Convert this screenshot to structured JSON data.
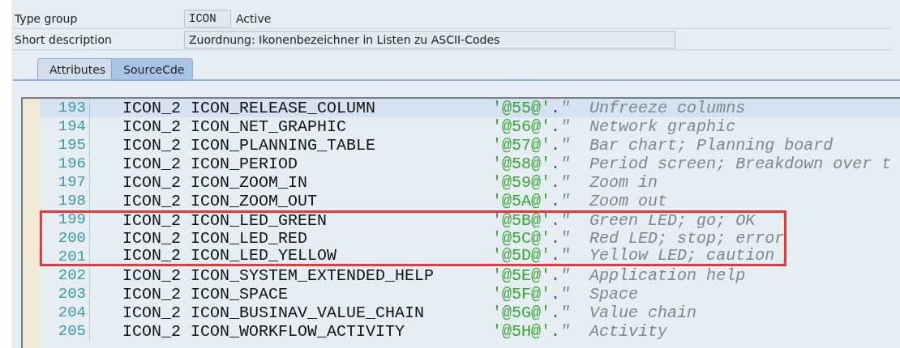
{
  "header": {
    "fields": [
      {
        "label": "Type group",
        "value": "ICON",
        "kind": "short",
        "status": "Active"
      },
      {
        "label": "Short description",
        "value": "Zuordnung: Ikonenbezeichner in Listen zu ASCII-Codes",
        "kind": "long"
      }
    ]
  },
  "tabs": [
    {
      "label": "Attributes",
      "selected": false
    },
    {
      "label": "SourceCde",
      "selected": true
    }
  ],
  "editor": {
    "lines": [
      {
        "number": "193",
        "statement": "ICON_2 ICON_RELEASE_COLUMN",
        "literal": "'@55@'",
        "terminator": ".",
        "comment": "\"  Unfreeze columns",
        "selected": true,
        "boxed": false
      },
      {
        "number": "194",
        "statement": "ICON_2 ICON_NET_GRAPHIC",
        "literal": "'@56@'",
        "terminator": ".",
        "comment": "\"  Network graphic",
        "selected": false,
        "boxed": false
      },
      {
        "number": "195",
        "statement": "ICON_2 ICON_PLANNING_TABLE",
        "literal": "'@57@'",
        "terminator": ".",
        "comment": "\"  Bar chart; Planning board",
        "selected": false,
        "boxed": false
      },
      {
        "number": "196",
        "statement": "ICON_2 ICON_PERIOD",
        "literal": "'@58@'",
        "terminator": ".",
        "comment": "\"  Period screen; Breakdown over t",
        "selected": false,
        "boxed": false
      },
      {
        "number": "197",
        "statement": "ICON_2 ICON_ZOOM_IN",
        "literal": "'@59@'",
        "terminator": ".",
        "comment": "\"  Zoom in",
        "selected": false,
        "boxed": false
      },
      {
        "number": "198",
        "statement": "ICON_2 ICON_ZOOM_OUT",
        "literal": "'@5A@'",
        "terminator": ".",
        "comment": "\"  Zoom out",
        "selected": false,
        "boxed": false
      },
      {
        "number": "199",
        "statement": "ICON_2 ICON_LED_GREEN",
        "literal": "'@5B@'",
        "terminator": ".",
        "comment": "\"  Green LED; go; OK",
        "selected": false,
        "boxed": true
      },
      {
        "number": "200",
        "statement": "ICON_2 ICON_LED_RED",
        "literal": "'@5C@'",
        "terminator": ".",
        "comment": "\"  Red LED; stop; error",
        "selected": false,
        "boxed": true
      },
      {
        "number": "201",
        "statement": "ICON_2 ICON_LED_YELLOW",
        "literal": "'@5D@'",
        "terminator": ".",
        "comment": "\"  Yellow LED; caution",
        "selected": false,
        "boxed": true
      },
      {
        "number": "202",
        "statement": "ICON_2 ICON_SYSTEM_EXTENDED_HELP",
        "literal": "'@5E@'",
        "terminator": ".",
        "comment": "\"  Application help",
        "selected": false,
        "boxed": false
      },
      {
        "number": "203",
        "statement": "ICON_2 ICON_SPACE",
        "literal": "'@5F@'",
        "terminator": ".",
        "comment": "\"  Space",
        "selected": false,
        "boxed": false
      },
      {
        "number": "204",
        "statement": "ICON_2 ICON_BUSINAV_VALUE_CHAIN",
        "literal": "'@5G@'",
        "terminator": ".",
        "comment": "\"  Value chain",
        "selected": false,
        "boxed": false
      },
      {
        "number": "205",
        "statement": "ICON_2 ICON_WORKFLOW_ACTIVITY",
        "literal": "'@5H@'",
        "terminator": ".",
        "comment": "\"  Activity",
        "selected": false,
        "boxed": false
      }
    ]
  }
}
